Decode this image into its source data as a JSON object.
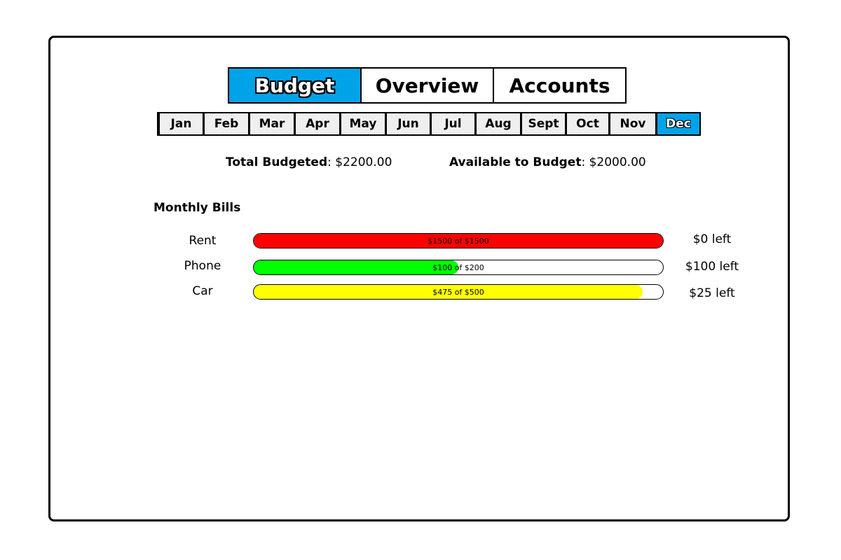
{
  "tabs": [
    {
      "label": "Budget",
      "active": true
    },
    {
      "label": "Overview",
      "active": false
    },
    {
      "label": "Accounts",
      "active": false
    }
  ],
  "months": [
    {
      "label": "Jan",
      "active": false
    },
    {
      "label": "Feb",
      "active": false
    },
    {
      "label": "Mar",
      "active": false
    },
    {
      "label": "Apr",
      "active": false
    },
    {
      "label": "May",
      "active": false
    },
    {
      "label": "Jun",
      "active": false
    },
    {
      "label": "Jul",
      "active": false
    },
    {
      "label": "Aug",
      "active": false
    },
    {
      "label": "Sept",
      "active": false
    },
    {
      "label": "Oct",
      "active": false
    },
    {
      "label": "Nov",
      "active": false
    },
    {
      "label": "Dec",
      "active": true
    }
  ],
  "totals": {
    "budgeted_label": "Total Budgeted",
    "budgeted_value": "$2200.00",
    "available_label": "Available to Budget",
    "available_value": "$2000.00"
  },
  "section_title": "Monthly Bills",
  "bills": [
    {
      "name": "Rent",
      "progress_text": "$1500 of $1500",
      "fraction": 1.0,
      "color": "#ff0000",
      "left_text": "$0 left"
    },
    {
      "name": "Phone",
      "progress_text": "$100 of $200",
      "fraction": 0.5,
      "color": "#00ff00",
      "left_text": "$100 left"
    },
    {
      "name": "Car",
      "progress_text": "$475 of $500",
      "fraction": 0.95,
      "color": "#ffff00",
      "left_text": "$25 left"
    }
  ],
  "colors": {
    "accent": "#00a3e8",
    "tab_inactive": "#efefef"
  }
}
